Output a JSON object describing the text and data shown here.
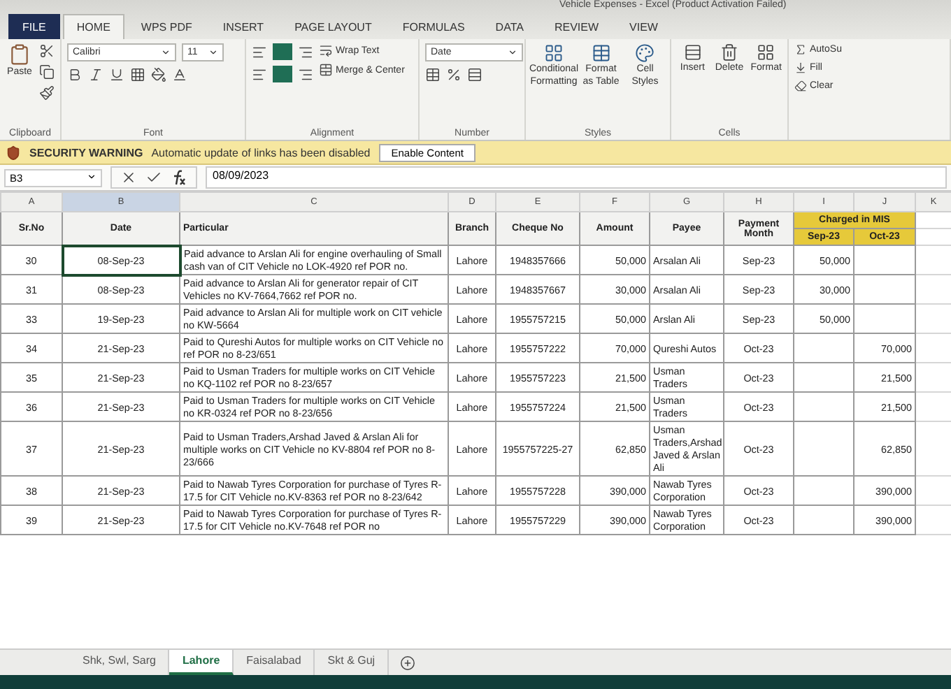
{
  "window": {
    "title": "Vehicle Expenses - Excel (Product Activation Failed)"
  },
  "ribbon_tabs": [
    {
      "label": "FILE",
      "kind": "file",
      "selected": false
    },
    {
      "label": "HOME",
      "kind": "tab",
      "selected": true
    },
    {
      "label": "WPS PDF",
      "kind": "tab",
      "selected": false
    },
    {
      "label": "INSERT",
      "kind": "tab",
      "selected": false
    },
    {
      "label": "PAGE LAYOUT",
      "kind": "tab",
      "selected": false
    },
    {
      "label": "FORMULAS",
      "kind": "tab",
      "selected": false
    },
    {
      "label": "DATA",
      "kind": "tab",
      "selected": false
    },
    {
      "label": "REVIEW",
      "kind": "tab",
      "selected": false
    },
    {
      "label": "VIEW",
      "kind": "tab",
      "selected": false
    }
  ],
  "ribbon": {
    "clipboard": {
      "paste": "Paste",
      "label": "Clipboard"
    },
    "font": {
      "name": "Calibri",
      "size": "11",
      "label": "Font"
    },
    "alignment": {
      "wrap": "Wrap Text",
      "merge": "Merge & Center",
      "label": "Alignment"
    },
    "number": {
      "format": "Date",
      "label": "Number"
    },
    "styles": {
      "buttons": [
        "Conditional Formatting",
        "Format as Table",
        "Cell Styles"
      ],
      "label": "Styles"
    },
    "cells": {
      "buttons": [
        "Insert",
        "Delete",
        "Format"
      ],
      "label": "Cells"
    },
    "editing": {
      "buttons": [
        "AutoSu",
        "Fill",
        "Clear"
      ]
    }
  },
  "security_bar": {
    "title": "SECURITY WARNING",
    "message": "Automatic update of links has been disabled",
    "button": "Enable Content"
  },
  "formula_bar": {
    "name_box": "B3",
    "value": "08/09/2023"
  },
  "column_letters": [
    {
      "label": "A",
      "selected": false
    },
    {
      "label": "B",
      "selected": true
    },
    {
      "label": "C",
      "selected": false
    },
    {
      "label": "D",
      "selected": false
    },
    {
      "label": "E",
      "selected": false
    },
    {
      "label": "F",
      "selected": false
    },
    {
      "label": "G",
      "selected": false
    },
    {
      "label": "H",
      "selected": false
    },
    {
      "label": "I",
      "selected": false
    },
    {
      "label": "J",
      "selected": false
    },
    {
      "label": "K",
      "selected": false
    }
  ],
  "table": {
    "columns": [
      "Sr.No",
      "Date",
      "Particular",
      "Branch",
      "Cheque No",
      "Amount",
      "Payee",
      "Payment Month"
    ],
    "group_header": "Charged in MIS",
    "group_columns": [
      "Sep-23",
      "Oct-23"
    ],
    "rows": [
      {
        "sr": "30",
        "date": "08-Sep-23",
        "particular": "Paid advance to Arslan Ali for engine overhauling of Small cash van of CIT Vehicle no LOK-4920 ref POR no.",
        "branch": "Lahore",
        "cheque": "1948357666",
        "amount": "50,000",
        "payee": "Arsalan Ali",
        "month": "Sep-23",
        "sep": "50,000",
        "oct": "",
        "selected": true
      },
      {
        "sr": "31",
        "date": "08-Sep-23",
        "particular": "Paid advance to Arslan Ali for generator repair of CIT Vehicles no KV-7664,7662 ref POR no.",
        "branch": "Lahore",
        "cheque": "1948357667",
        "amount": "30,000",
        "payee": "Arsalan Ali",
        "month": "Sep-23",
        "sep": "30,000",
        "oct": "",
        "selected": false
      },
      {
        "sr": "33",
        "date": "19-Sep-23",
        "particular": "Paid advance to Arslan Ali for multiple work on CIT vehicle no KW-5664",
        "branch": "Lahore",
        "cheque": "1955757215",
        "amount": "50,000",
        "payee": "Arslan Ali",
        "month": "Sep-23",
        "sep": "50,000",
        "oct": "",
        "selected": false
      },
      {
        "sr": "34",
        "date": "21-Sep-23",
        "particular": "Paid to Qureshi Autos for multiple works on CIT Vehicle no ref POR no 8-23/651",
        "branch": "Lahore",
        "cheque": "1955757222",
        "amount": "70,000",
        "payee": "Qureshi Autos",
        "month": "Oct-23",
        "sep": "",
        "oct": "70,000",
        "selected": false
      },
      {
        "sr": "35",
        "date": "21-Sep-23",
        "particular": "Paid to Usman Traders for multiple works on CIT Vehicle no KQ-1102 ref POR no 8-23/657",
        "branch": "Lahore",
        "cheque": "1955757223",
        "amount": "21,500",
        "payee": "Usman Traders",
        "month": "Oct-23",
        "sep": "",
        "oct": "21,500",
        "selected": false
      },
      {
        "sr": "36",
        "date": "21-Sep-23",
        "particular": "Paid to Usman Traders for multiple works on CIT Vehicle no KR-0324 ref POR no 8-23/656",
        "branch": "Lahore",
        "cheque": "1955757224",
        "amount": "21,500",
        "payee": "Usman Traders",
        "month": "Oct-23",
        "sep": "",
        "oct": "21,500",
        "selected": false
      },
      {
        "sr": "37",
        "date": "21-Sep-23",
        "particular": "Paid to Usman Traders,Arshad Javed & Arslan Ali for multiple works on CIT Vehicle no KV-8804 ref POR no 8-23/666",
        "branch": "Lahore",
        "cheque": "1955757225-27",
        "amount": "62,850",
        "payee": "Usman Traders,Arshad Javed & Arslan Ali",
        "month": "Oct-23",
        "sep": "",
        "oct": "62,850",
        "selected": false
      },
      {
        "sr": "38",
        "date": "21-Sep-23",
        "particular": "Paid to Nawab Tyres Corporation for purchase of Tyres R-17.5 for CIT Vehicle no.KV-8363 ref POR no 8-23/642",
        "branch": "Lahore",
        "cheque": "1955757228",
        "amount": "390,000",
        "payee": "Nawab Tyres Corporation",
        "month": "Oct-23",
        "sep": "",
        "oct": "390,000",
        "selected": false
      },
      {
        "sr": "39",
        "date": "21-Sep-23",
        "particular": "Paid to Nawab Tyres Corporation for purchase of Tyres R-17.5 for CIT Vehicle no.KV-7648 ref POR no",
        "branch": "Lahore",
        "cheque": "1955757229",
        "amount": "390,000",
        "payee": "Nawab Tyres Corporation",
        "month": "Oct-23",
        "sep": "",
        "oct": "390,000",
        "selected": false
      }
    ]
  },
  "sheet_tabs": [
    {
      "label": "Shk, Swl, Sarg",
      "selected": false
    },
    {
      "label": "Lahore",
      "selected": true
    },
    {
      "label": "Faisalabad",
      "selected": false
    },
    {
      "label": "Skt & Guj",
      "selected": false
    }
  ]
}
